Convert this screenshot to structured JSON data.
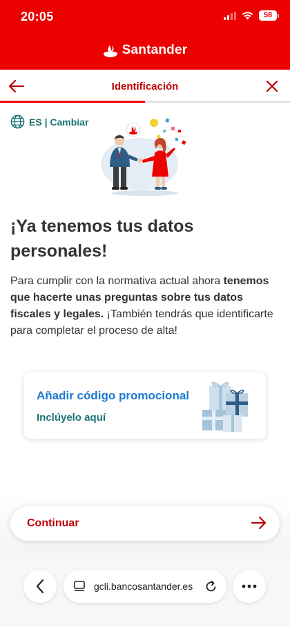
{
  "status_bar": {
    "time": "20:05",
    "battery": "58"
  },
  "brand": {
    "name": "Santander"
  },
  "titlebar": {
    "title": "Identificación",
    "progress_fraction": 0.5
  },
  "language": {
    "label": "ES | Cambiar"
  },
  "content": {
    "headline_line1": "¡Ya tenemos tus datos",
    "headline_line2": "personales!",
    "body_part1": "Para cumplir con la normativa actual ahora ",
    "body_bold": "tenemos que hacerte unas preguntas sobre tus datos fiscales y legales.",
    "body_part2": " ¡También tendrás que identificarte para completar el proceso de alta!"
  },
  "promo": {
    "title": "Añadir código promocional",
    "subtitle": "Inclúyelo aquí"
  },
  "continue_button": {
    "label": "Continuar"
  },
  "browser": {
    "url": "gcli.bancosantander.es"
  },
  "icons": {
    "back": "arrow-left-icon",
    "close": "close-icon",
    "globe": "globe-icon",
    "continue": "arrow-right-icon",
    "nav_back": "chevron-left-icon",
    "tab": "tab-icon",
    "reload": "reload-icon",
    "more": "more-icon"
  },
  "colors": {
    "brand_red": "#ec0000",
    "dark_red": "#c00000",
    "teal": "#1a7574",
    "link_blue": "#1b7ad0"
  }
}
